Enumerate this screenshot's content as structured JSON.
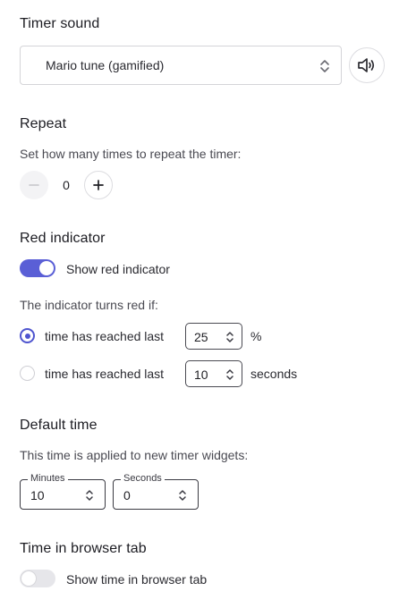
{
  "timer_sound": {
    "heading": "Timer sound",
    "selected": "Mario tune (gamified)",
    "sound_icon": "speaker-icon"
  },
  "repeat": {
    "heading": "Repeat",
    "description": "Set how many times to repeat the timer:",
    "value": "0"
  },
  "red_indicator": {
    "heading": "Red indicator",
    "toggle_label": "Show red indicator",
    "toggle_on": true,
    "description": "The indicator turns red if:",
    "option1_label": "time has reached last",
    "option1_value": "25",
    "option1_unit": "%",
    "option2_label": "time has reached last",
    "option2_value": "10",
    "option2_unit": "seconds",
    "selected_option": 1
  },
  "default_time": {
    "heading": "Default time",
    "description": "This time is applied to new timer widgets:",
    "minutes_label": "Minutes",
    "minutes_value": "10",
    "seconds_label": "Seconds",
    "seconds_value": "0"
  },
  "browser_tab": {
    "heading": "Time in browser tab",
    "toggle_label": "Show time in browser tab",
    "toggle_on": false
  },
  "colors": {
    "accent": "#5a5fd6",
    "text": "#1f1f24",
    "border": "#d4d4d8"
  }
}
